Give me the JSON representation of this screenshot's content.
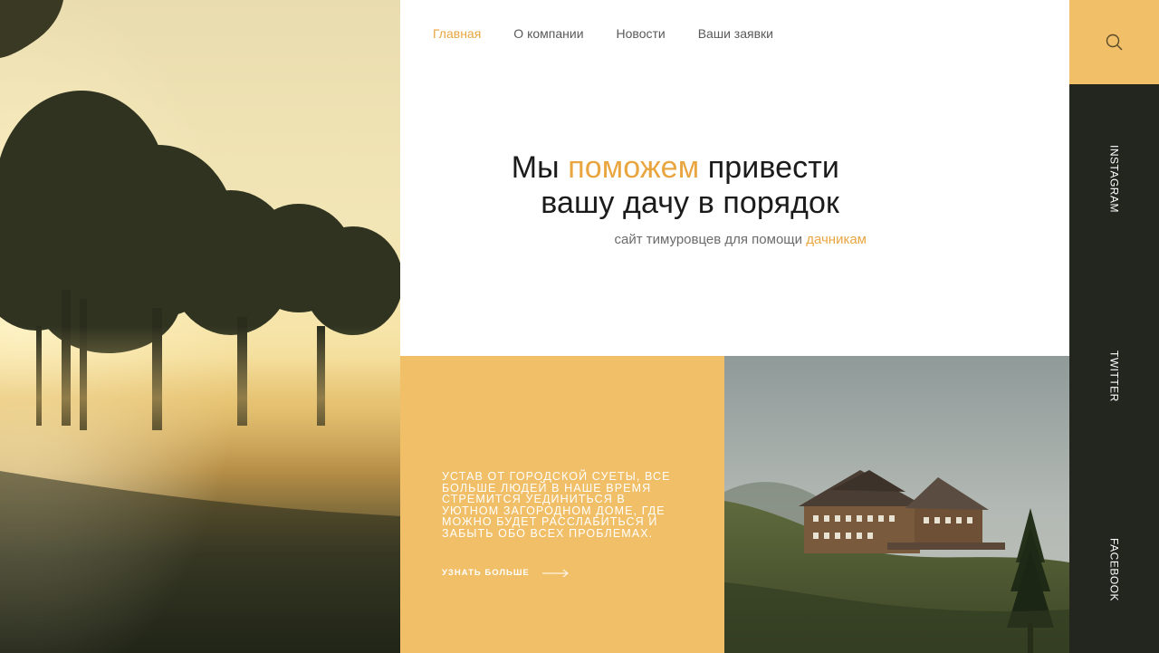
{
  "nav": {
    "items": [
      {
        "label": "Главная",
        "active": true
      },
      {
        "label": "О компании",
        "active": false
      },
      {
        "label": "Новости",
        "active": false
      },
      {
        "label": "Ваши заявки",
        "active": false
      }
    ]
  },
  "hero": {
    "headline_part1": "Мы ",
    "headline_accent": "поможем",
    "headline_part2": " привести",
    "headline_line2": "вашу дачу в порядок",
    "subtitle_main": "сайт тимуровцев для помощи ",
    "subtitle_accent": "дачникам"
  },
  "card": {
    "text": "УСТАВ ОТ ГОРОДСКОЙ СУЕТЫ, ВСЕ БОЛЬШЕ ЛЮДЕЙ В НАШЕ ВРЕМЯ СТРЕМИТСЯ УЕДИНИТЬСЯ В УЮТНОМ ЗАГОРОДНОМ ДОМЕ, ГДЕ МОЖНО БУДЕТ РАССЛАБИТЬСЯ И ЗАБЫТЬ ОБО ВСЕХ ПРОБЛЕМАХ.",
    "link_label": "УЗНАТЬ БОЛЬШЕ"
  },
  "sidebar": {
    "search_icon": "search-icon",
    "social": {
      "instagram": "INSTAGRAM",
      "twitter": "TWITTER",
      "facebook": "FACEBOOK"
    }
  },
  "colors": {
    "accent": "#e9a640",
    "card_bg": "#f0bf68",
    "sidebar_bg": "#23251f"
  }
}
